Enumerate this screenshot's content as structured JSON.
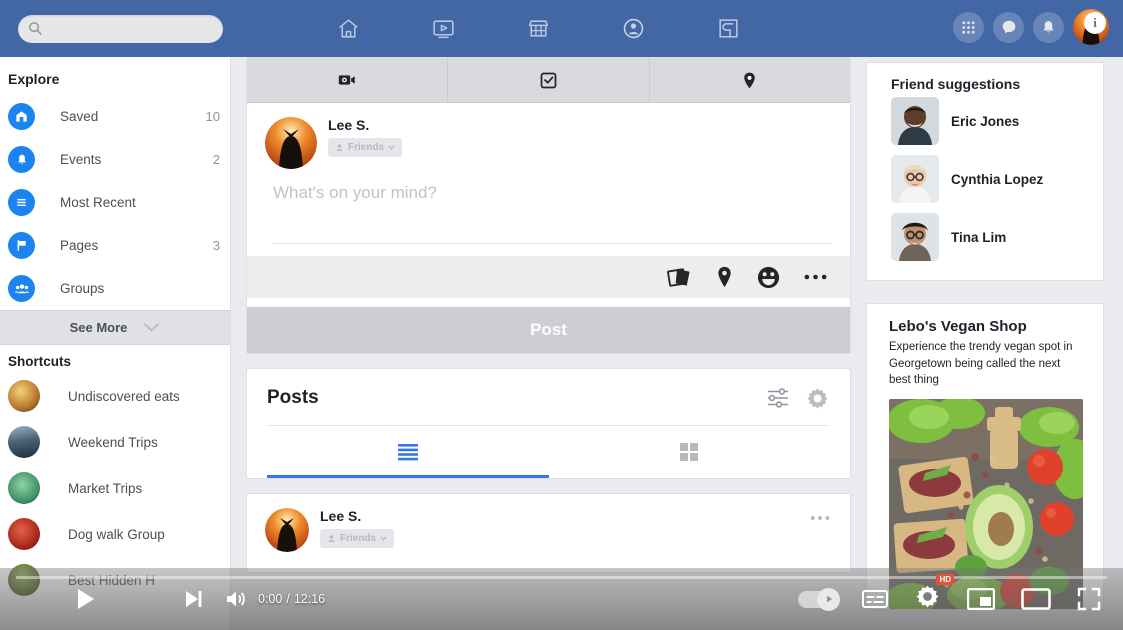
{
  "topbar": {
    "brand_color": "#4267a4",
    "search": {
      "placeholder": "",
      "value": "",
      "icon": "search-icon"
    },
    "nav": [
      {
        "icon": "home-icon",
        "name": "home"
      },
      {
        "icon": "video-icon",
        "name": "watch"
      },
      {
        "icon": "marketplace-icon",
        "name": "marketplace"
      },
      {
        "icon": "profile-icon",
        "name": "profile"
      },
      {
        "icon": "groups-icon",
        "name": "groups"
      }
    ],
    "actions": [
      {
        "icon": "apps-grid-icon",
        "name": "apps"
      },
      {
        "icon": "messenger-icon",
        "name": "messages"
      },
      {
        "icon": "bell-icon",
        "name": "notifications"
      },
      {
        "icon": "avatar-icon",
        "name": "account",
        "badge": "i"
      }
    ]
  },
  "sidebar": {
    "explore_title": "Explore",
    "items": [
      {
        "label": "Saved",
        "count": "10",
        "icon": "bookmark-icon"
      },
      {
        "label": "Events",
        "count": "2",
        "icon": "bell-icon"
      },
      {
        "label": "Most Recent",
        "count": "",
        "icon": "list-icon"
      },
      {
        "label": "Pages",
        "count": "3",
        "icon": "flag-icon"
      },
      {
        "label": "Groups",
        "count": "",
        "icon": "people-icon"
      }
    ],
    "see_more": "See More",
    "shortcuts_title": "Shortcuts",
    "shortcuts": [
      {
        "label": "Undiscovered eats",
        "color1": "#e8c06a",
        "color2": "#9c6b2f"
      },
      {
        "label": "Weekend Trips",
        "color1": "#6f8aa0",
        "color2": "#243543"
      },
      {
        "label": "Market Trips",
        "color1": "#5fae84",
        "color2": "#2c6a4a"
      },
      {
        "label": "Dog walk Group",
        "color1": "#c8402c",
        "color2": "#7a2016"
      },
      {
        "label": "Best Hidden H",
        "color1": "#6b7a3a",
        "color2": "#2f3a18"
      }
    ]
  },
  "composer": {
    "tabs": [
      {
        "icon": "video-camera-icon",
        "name": "live-video"
      },
      {
        "icon": "checkbox-square-icon",
        "name": "life-event"
      },
      {
        "icon": "location-pin-icon",
        "name": "check-in"
      }
    ],
    "user_name": "Lee S.",
    "privacy_label": "Friends",
    "placeholder": "What's on your mind?",
    "toolbar_icons": [
      {
        "icon": "photos-icon",
        "name": "photo-video"
      },
      {
        "icon": "location-pin-icon",
        "name": "check-in"
      },
      {
        "icon": "emoji-icon",
        "name": "feeling-activity"
      },
      {
        "icon": "ellipsis-icon",
        "name": "more-options"
      }
    ],
    "post_label": "Post"
  },
  "posts": {
    "title": "Posts",
    "filter_icon": "sliders-icon",
    "settings_icon": "gear-icon",
    "views": [
      {
        "name": "list-view",
        "icon": "list-lines-icon",
        "active": true
      },
      {
        "name": "grid-view",
        "icon": "grid-squares-icon",
        "active": false
      }
    ]
  },
  "feed": {
    "post": {
      "author": "Lee S.",
      "privacy_label": "Friends",
      "menu_icon": "ellipsis-icon"
    }
  },
  "right_sidebar": {
    "friend_suggestions_title": "Friend suggestions",
    "friends": [
      {
        "name": "Eric Jones",
        "skin": "#6b4a35",
        "bg": "#d9dde0"
      },
      {
        "name": "Cynthia Lopez",
        "skin": "#e8c3a4",
        "bg": "#e6ecef"
      },
      {
        "name": "Tina Lim",
        "skin": "#b98a6b",
        "bg": "#dfe4e7"
      }
    ],
    "ad": {
      "title": "Lebo's Vegan Shop",
      "description": "Experience the trendy vegan spot in Georgetown being called the next best thing"
    }
  },
  "video_player": {
    "play_icon": "play-icon",
    "next_icon": "next-track-icon",
    "volume_icon": "volume-icon",
    "current_time": "0:00",
    "duration": "12:16",
    "time_separator": "/",
    "progress_percent": 0,
    "controls": [
      {
        "icon": "autoplay-toggle-icon",
        "name": "autoplay-toggle"
      },
      {
        "icon": "subtitles-icon",
        "name": "subtitles"
      },
      {
        "icon": "gear-icon",
        "name": "settings",
        "badge": "HD"
      },
      {
        "icon": "picture-in-picture-icon",
        "name": "picture-in-picture"
      },
      {
        "icon": "theater-mode-icon",
        "name": "theater-mode"
      },
      {
        "icon": "fullscreen-icon",
        "name": "fullscreen"
      }
    ]
  }
}
